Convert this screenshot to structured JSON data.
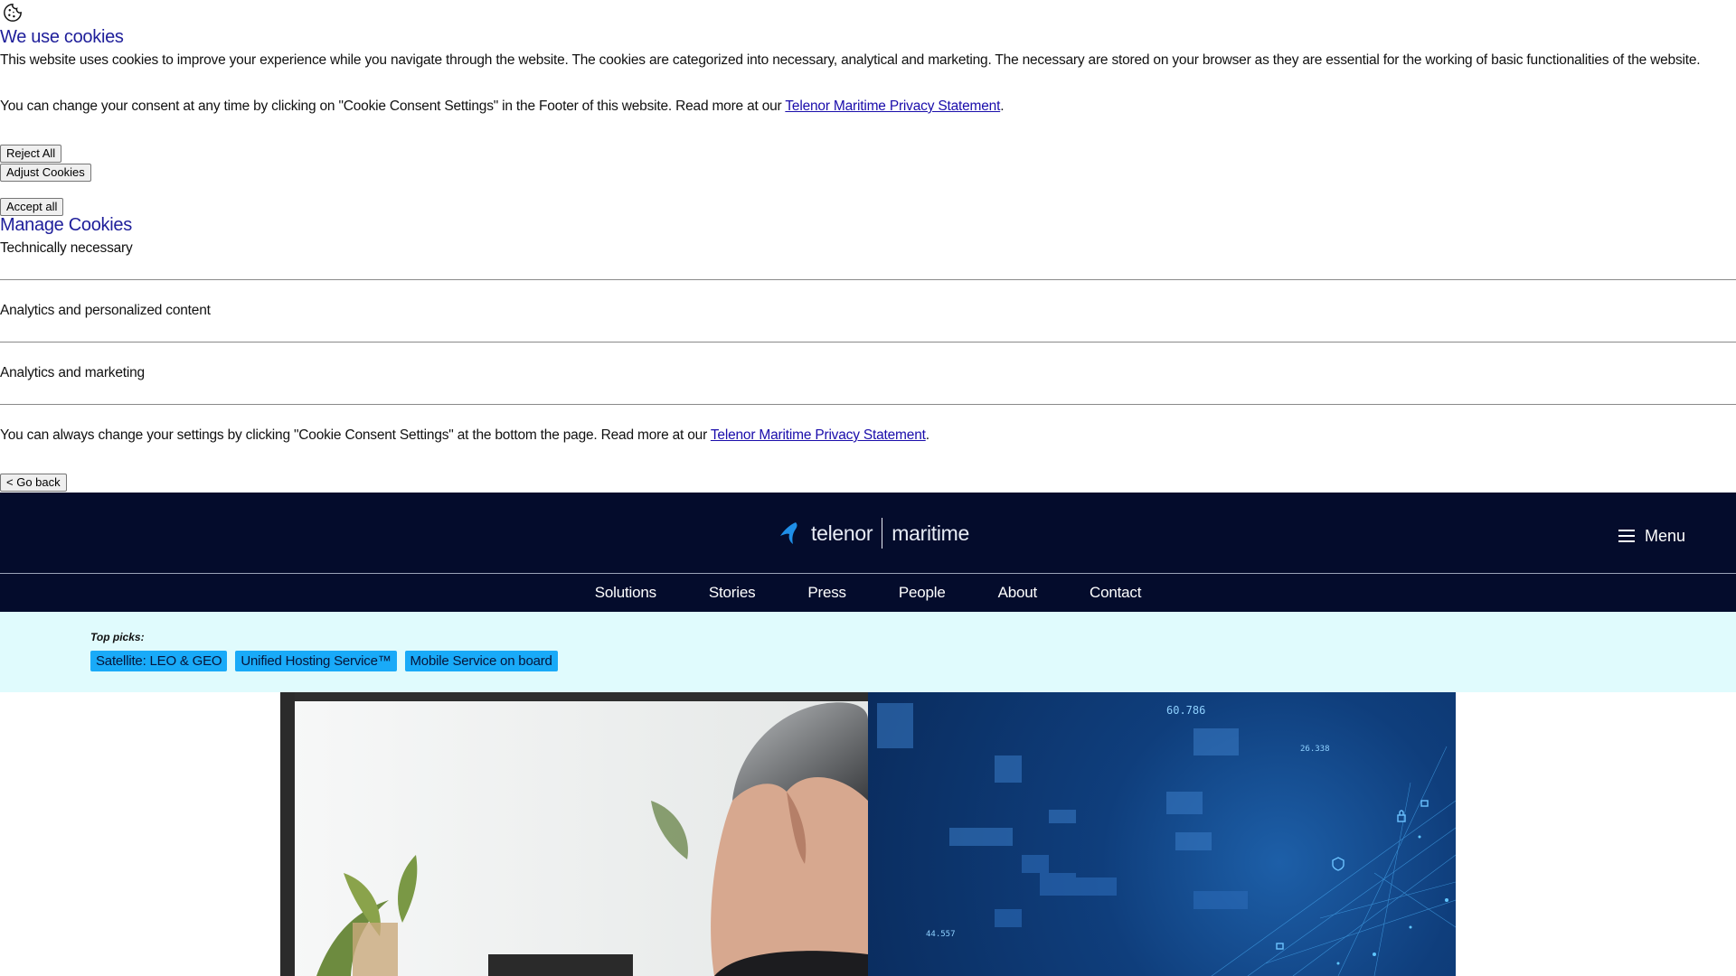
{
  "cookie_banner": {
    "icon": "cookie-icon",
    "title": "We use cookies",
    "description": "This website uses cookies to improve your experience while you navigate through the website. The cookies are categorized into necessary, analytical and marketing. The necessary are stored on your browser as they are essential for the working of basic functionalities of the website.",
    "consent_text": "You can change your consent at any time by clicking on \"Cookie Consent Settings\" in the Footer of this website. Read more at our ",
    "privacy_link": "Telenor Maritime Privacy Statement",
    "period": ".",
    "reject_label": "Reject All",
    "adjust_label": "Adjust Cookies",
    "accept_label": "Accept all",
    "manage_title": "Manage Cookies",
    "categories": [
      {
        "label": "Technically necessary"
      },
      {
        "label": "Analytics and personalized content"
      },
      {
        "label": "Analytics and marketing"
      }
    ],
    "change_text": "You can always change your settings by clicking \"Cookie Consent Settings\" at the bottom the page. Read more at our ",
    "change_link": "Telenor Maritime Privacy Statement",
    "back_label": "< Go back"
  },
  "header": {
    "logo_brand": "telenor",
    "logo_product": "maritime",
    "menu_label": "Menu",
    "nav": [
      {
        "label": "Solutions"
      },
      {
        "label": "Stories"
      },
      {
        "label": "Press"
      },
      {
        "label": "People"
      },
      {
        "label": "About"
      },
      {
        "label": "Contact"
      }
    ]
  },
  "top_picks": {
    "label": "Top picks:",
    "tags": [
      {
        "label": "Satellite: LEO & GEO"
      },
      {
        "label": "Unified Hosting Service™"
      },
      {
        "label": "Mobile Service on board"
      }
    ]
  },
  "hero": {
    "data_overlay_numbers": [
      "60.786",
      "26.338",
      "44.557"
    ]
  },
  "colors": {
    "header_bg": "#040c2c",
    "heading": "#1e1e9a",
    "top_picks_bg": "#e0fbfd",
    "tag_bg": "#19aaf8",
    "logo_blue": "#1f8fe8"
  }
}
